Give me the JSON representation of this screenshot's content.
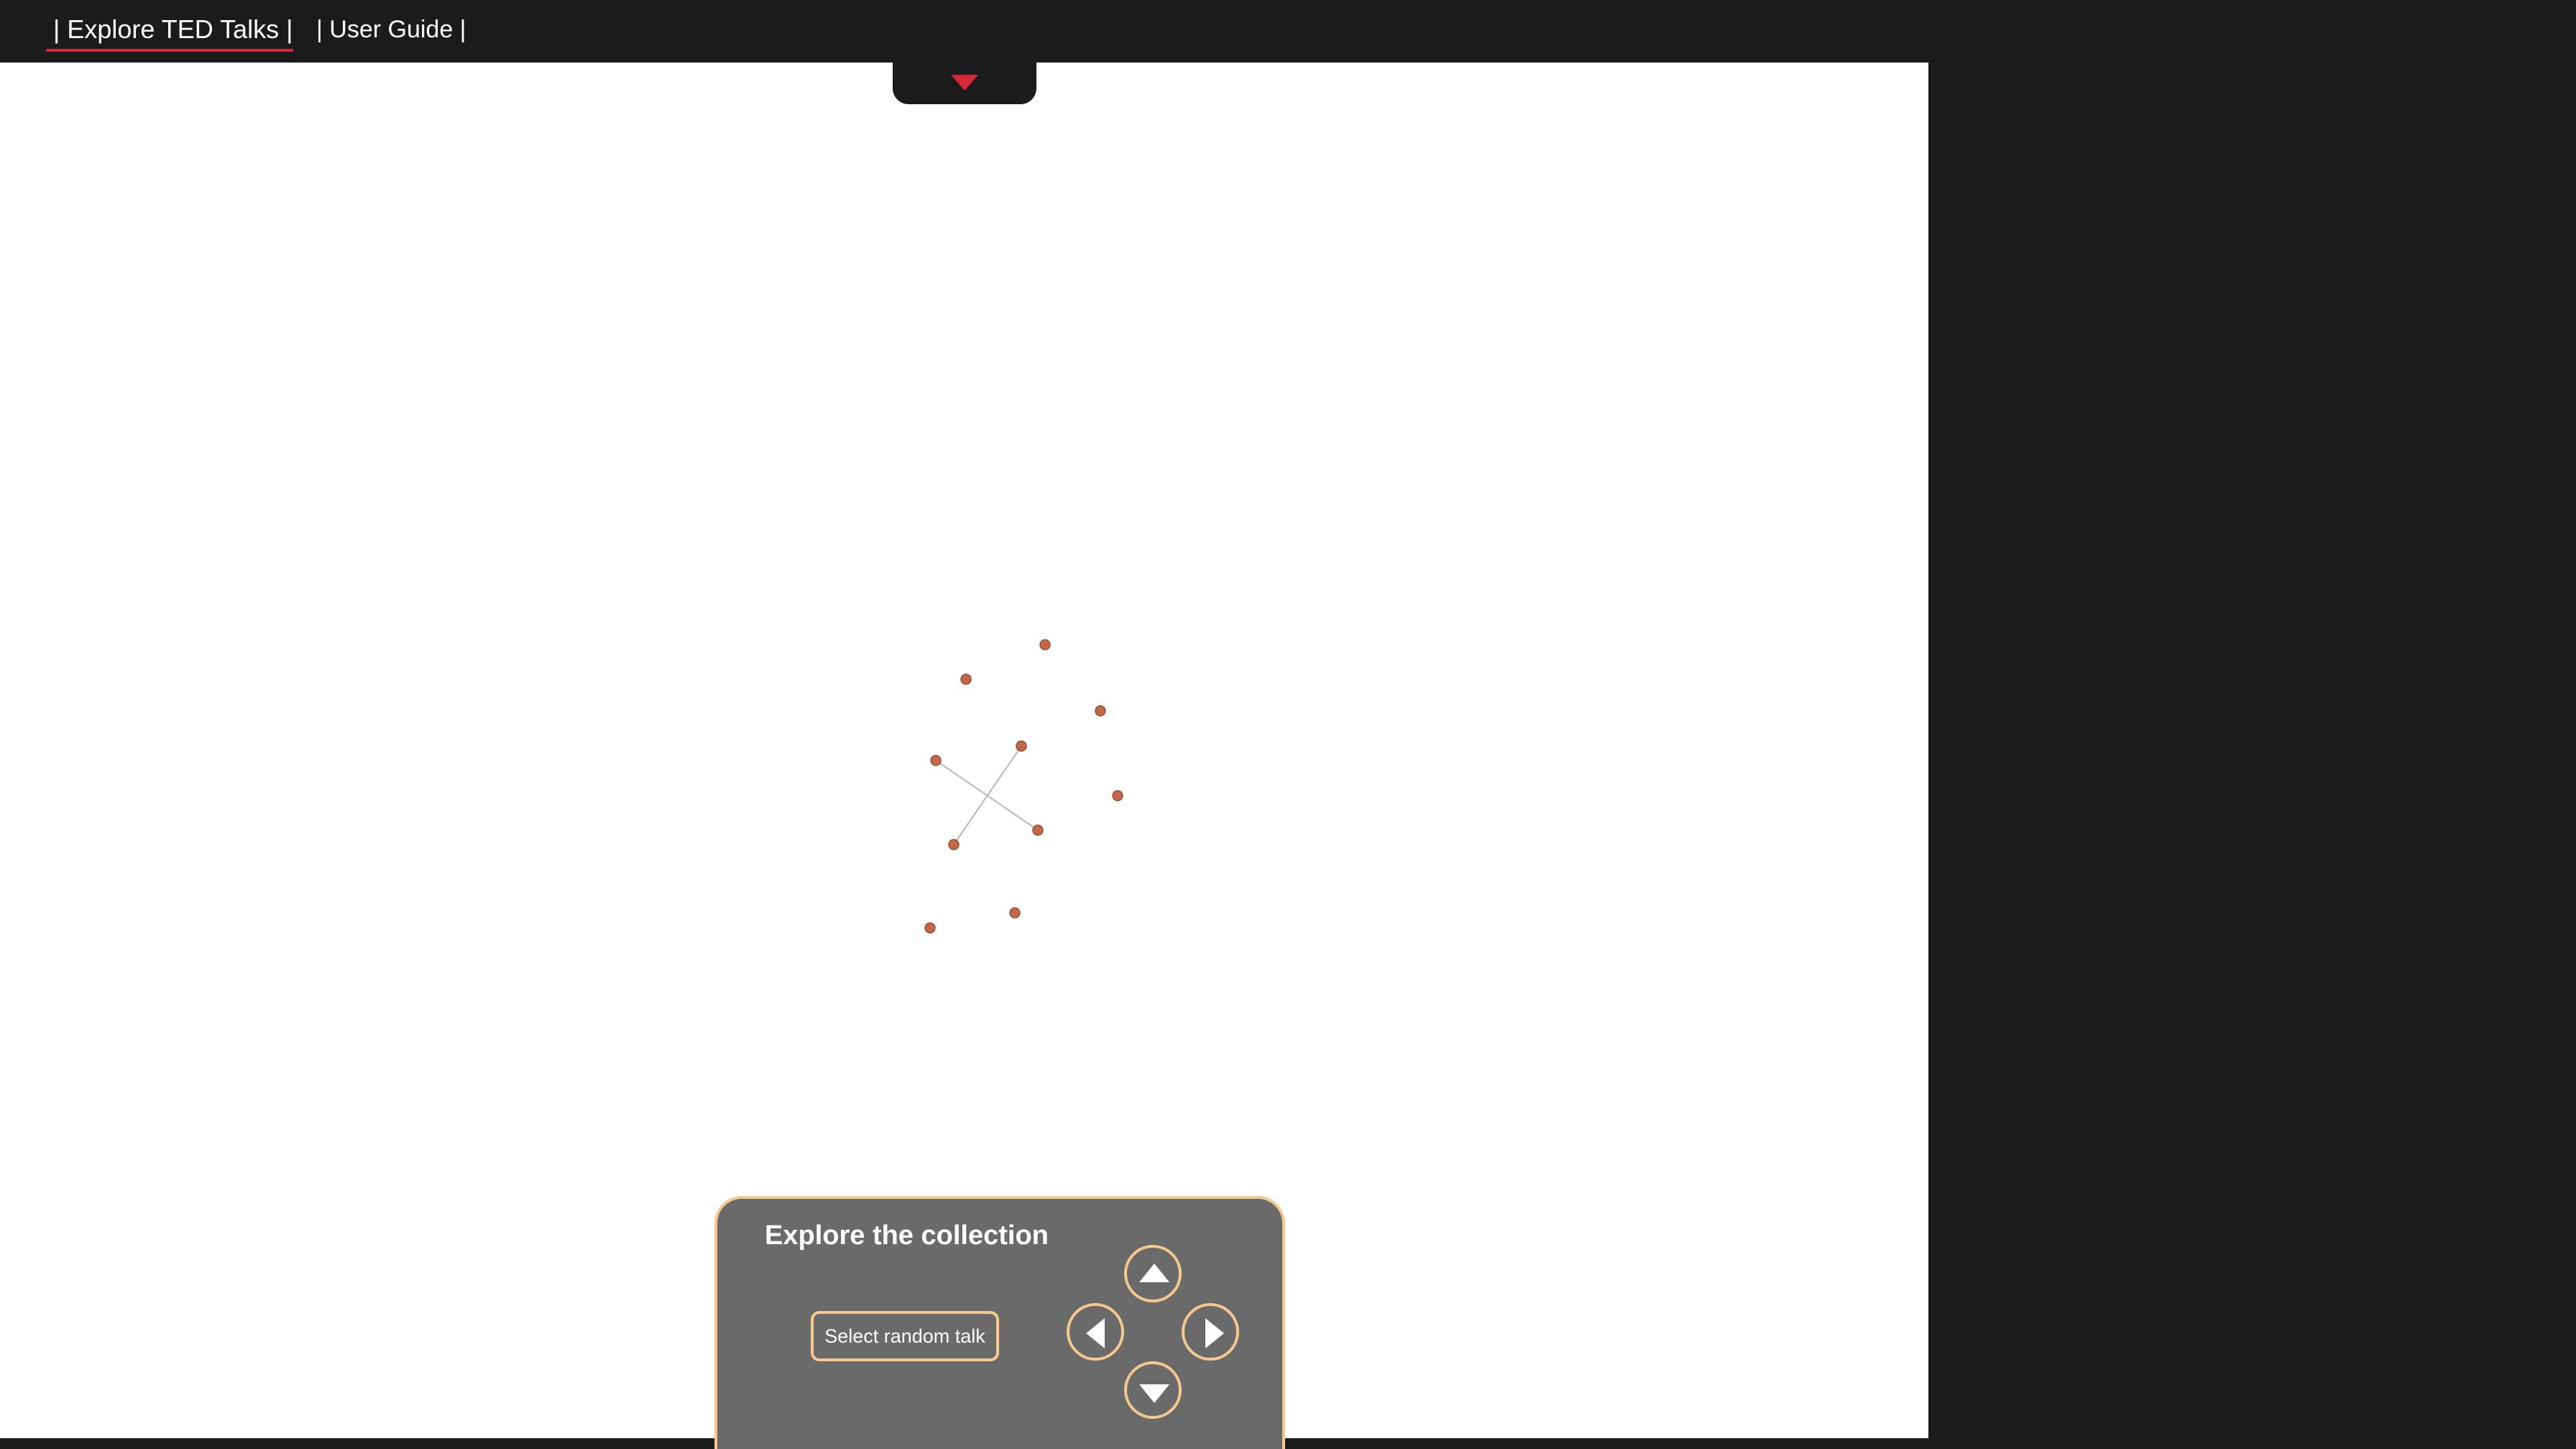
{
  "nav": {
    "explore_label": "| Explore TED Talks |",
    "guide_label": "| User Guide |"
  },
  "colors": {
    "background": "#1b1b1b",
    "accent": "#d62839",
    "panel": "#6a6a6a",
    "panel_border": "#f3c98f",
    "node": "#c0694a"
  },
  "graph": {
    "node_count": 11,
    "link_count": 2
  },
  "panel": {
    "title": "Explore the collection",
    "random_button_label": "Select random talk",
    "arrow_icons": [
      "arrow-up-icon",
      "arrow-left-icon",
      "arrow-right-icon",
      "arrow-down-icon"
    ]
  }
}
